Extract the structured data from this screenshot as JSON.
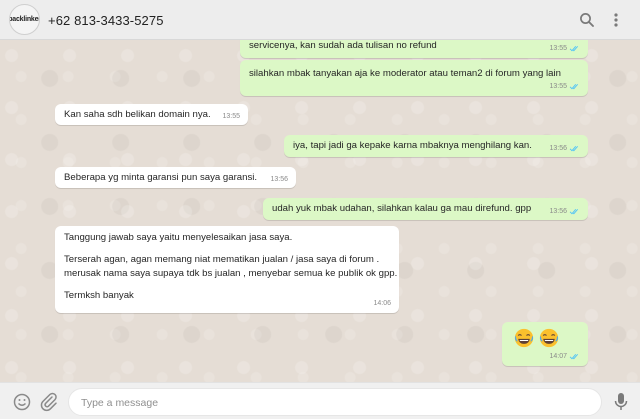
{
  "header": {
    "avatar_text": "backlinker",
    "contact": "+62 813-3433-5275",
    "icons": [
      "search-icon",
      "menu-dots-icon"
    ]
  },
  "messages": [
    {
      "dir": "out",
      "text": "servicenya, kan sudah ada tulisan no refund",
      "time": "13:55",
      "status": "read"
    },
    {
      "dir": "out",
      "text": "silahkan mbak tanyakan aja ke moderator atau teman2 di forum yang lain",
      "time": "13:55",
      "status": "read"
    },
    {
      "dir": "in",
      "text": "Kan saha sdh belikan domain nya.",
      "time": "13:55"
    },
    {
      "dir": "out",
      "text": "iya, tapi jadi ga kepake karna mbaknya menghilang kan.",
      "time": "13:56",
      "status": "read"
    },
    {
      "dir": "in",
      "text": "Beberapa yg minta garansi pun saya garansi.",
      "time": "13:56"
    },
    {
      "dir": "out",
      "text": "udah yuk mbak udahan, silahkan kalau ga mau direfund. gpp",
      "time": "13:56",
      "status": "read"
    },
    {
      "dir": "in",
      "lines": [
        "Tanggung jawab saya yaitu menyelesaikan jasa saya.",
        "",
        "Terserah agan, agan memang niat mematikan jualan / jasa saya di forum .",
        "merusak nama saya supaya tdk bs jualan , menyebar semua ke publik ok gpp.",
        "",
        "Termksh banyak"
      ],
      "time": "14:06"
    },
    {
      "dir": "out",
      "emoji": "😂😂",
      "time": "14:07",
      "status": "read"
    }
  ],
  "composer": {
    "placeholder": "Type a message",
    "icons": [
      "emoji-icon",
      "attach-icon",
      "microphone-icon"
    ]
  },
  "colors": {
    "outgoing": "#dcf8c6",
    "incoming": "#ffffff",
    "read_tick": "#4fc3f7",
    "chat_bg": "#e5ddd5"
  }
}
